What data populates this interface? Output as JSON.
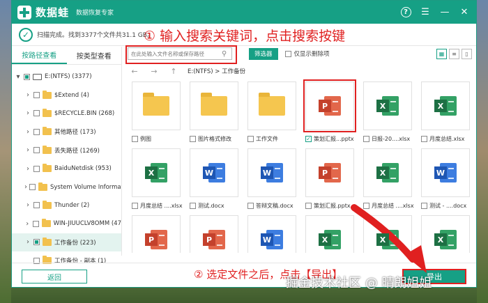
{
  "titlebar": {
    "app_name": "数据蛙",
    "subtitle": "数据恢复专家"
  },
  "status": {
    "text": "扫描完成。找到3377个文件共31.1 GB。"
  },
  "annotations": {
    "step1": "① 输入搜索关键词，点击搜索按键",
    "step2": "② 选定文件之后，点击【导出】"
  },
  "sidebar": {
    "tabs": [
      {
        "label": "按路径查看",
        "active": true
      },
      {
        "label": "按类型查看",
        "active": false
      }
    ],
    "items": [
      {
        "label": "E:(NTFS) (3377)",
        "level": "root",
        "icon": "drive-icon",
        "expanded": true
      },
      {
        "label": "$Extend (4)",
        "level": "child",
        "icon": "folder-icon"
      },
      {
        "label": "$RECYCLE.BIN (268)",
        "level": "child",
        "icon": "folder-icon"
      },
      {
        "label": "其他路径 (173)",
        "level": "child",
        "icon": "folder-icon"
      },
      {
        "label": "丢失路径 (1269)",
        "level": "child",
        "icon": "folder-icon"
      },
      {
        "label": "BaiduNetdisk (953)",
        "level": "child",
        "icon": "folder-icon"
      },
      {
        "label": "System Volume Informat",
        "level": "child",
        "icon": "folder-icon"
      },
      {
        "label": "Thunder (2)",
        "level": "child",
        "icon": "folder-icon"
      },
      {
        "label": "WIN-JIUUCLV8OMM (47",
        "level": "child",
        "icon": "folder-icon"
      },
      {
        "label": "工作备份 (223)",
        "level": "child",
        "icon": "folder-icon",
        "selected": true
      },
      {
        "label": "工作备份 - 副本 (1)",
        "level": "child",
        "icon": "folder-icon",
        "no_caret": true
      }
    ]
  },
  "toolbar": {
    "search_placeholder": "在此处输入文件名称或保存路径",
    "filter_label": "筛选器",
    "show_deleted_label": "仅显示删除项"
  },
  "pathbar": {
    "path": "E:(NTFS) > 工作备份"
  },
  "files": [
    {
      "name": "例图",
      "type": "folder"
    },
    {
      "name": "图片格式修改",
      "type": "folder"
    },
    {
      "name": "工作文件",
      "type": "folder"
    },
    {
      "name": "策划汇报...pptx",
      "type": "ppt",
      "checked": true,
      "highlighted": true
    },
    {
      "name": "日报-20....xlsx",
      "type": "xls"
    },
    {
      "name": "月度总结.xlsx",
      "type": "xls"
    },
    {
      "name": "月度总结 ....xlsx",
      "type": "xls"
    },
    {
      "name": "测试.docx",
      "type": "doc"
    },
    {
      "name": "答辩文稿.docx",
      "type": "doc"
    },
    {
      "name": "策划汇报.pptx",
      "type": "ppt"
    },
    {
      "name": "月度总结 ....xlsx",
      "type": "xls"
    },
    {
      "name": "测试 - ....docx",
      "type": "doc"
    },
    {
      "name": "",
      "type": "ppt"
    },
    {
      "name": "",
      "type": "ppt"
    },
    {
      "name": "",
      "type": "doc"
    },
    {
      "name": "",
      "type": "xls"
    },
    {
      "name": "",
      "type": "xls"
    },
    {
      "name": "",
      "type": "xls"
    }
  ],
  "footer": {
    "back_label": "返回",
    "export_label": "导出"
  },
  "watermark": "掘金技术社区 @ 晴朗姐姐",
  "colors": {
    "accent": "#16a085",
    "annotation": "#e02020"
  }
}
